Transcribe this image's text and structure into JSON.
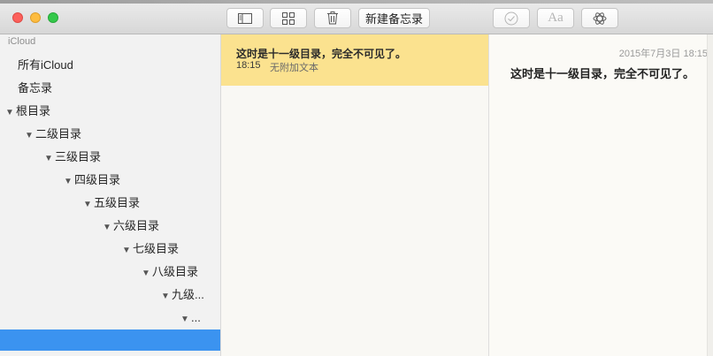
{
  "toolbar": {
    "new_note_label": "新建备忘录",
    "sidebar_toggle_icon": "sidebar-icon",
    "grid_icon": "attachments-grid-icon",
    "trash_icon": "trash-icon",
    "checklist_icon": "checklist-icon",
    "format_label": "Aa",
    "share_icon": "share-icon"
  },
  "sidebar": {
    "section_title": "iCloud",
    "items": [
      {
        "label": "所有iCloud"
      },
      {
        "label": "备忘录"
      },
      {
        "label": "根目录"
      },
      {
        "label": "二级目录"
      },
      {
        "label": "三级目录"
      },
      {
        "label": "四级目录"
      },
      {
        "label": "五级目录"
      },
      {
        "label": "六级目录"
      },
      {
        "label": "七级目录"
      },
      {
        "label": "八级目录"
      },
      {
        "label": "九级..."
      },
      {
        "label": "..."
      }
    ]
  },
  "notes_list": {
    "notes": [
      {
        "title": "这时是十一级目录，完全不可见了。",
        "time": "18:15",
        "preview": "无附加文本"
      }
    ]
  },
  "editor": {
    "date": "2015年7月3日 18:15",
    "body": "这时是十一级目录，完全不可见了。"
  },
  "colors": {
    "selected_note": "#fbe28f",
    "sidebar_selection": "#3b93f0",
    "close": "#fc605b",
    "minimize": "#fdbc40",
    "zoom": "#34c84a"
  }
}
